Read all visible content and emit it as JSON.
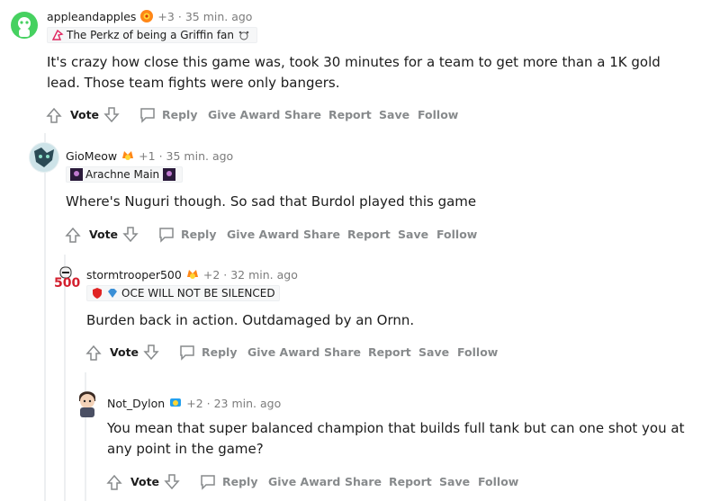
{
  "comments": [
    {
      "username": "appleandapples",
      "points": "+3",
      "time": "35 min. ago",
      "flair": "The Perkz of being a Griffin fan",
      "body": "It's crazy how close this game was, took 30 minutes for a team to get more than a 1K gold lead. Those team fights were only bangers."
    },
    {
      "username": "GioMeow",
      "points": "+1",
      "time": "35 min. ago",
      "flair": "Arachne Main",
      "body": "Where's Nuguri though. So sad that Burdol played this game"
    },
    {
      "username": "stormtrooper500",
      "points": "+2",
      "time": "32 min. ago",
      "flair": "OCE WILL NOT BE SILENCED",
      "avatar_text": "500",
      "body": "Burden back in action. Outdamaged by an Ornn."
    },
    {
      "username": "Not_Dylon",
      "points": "+2",
      "time": "23 min. ago",
      "body": "You mean that super balanced champion that builds full tank but can one shot you at any point in the game?"
    }
  ],
  "actions": {
    "vote": "Vote",
    "reply": "Reply",
    "give_award": "Give Award",
    "share": "Share",
    "report": "Report",
    "save": "Save",
    "follow": "Follow"
  },
  "separator": "·",
  "colors": {
    "meta": "#7c7c7c",
    "action": "#878a8c",
    "thread": "#edeff1",
    "avatar_green": "#46d160"
  }
}
